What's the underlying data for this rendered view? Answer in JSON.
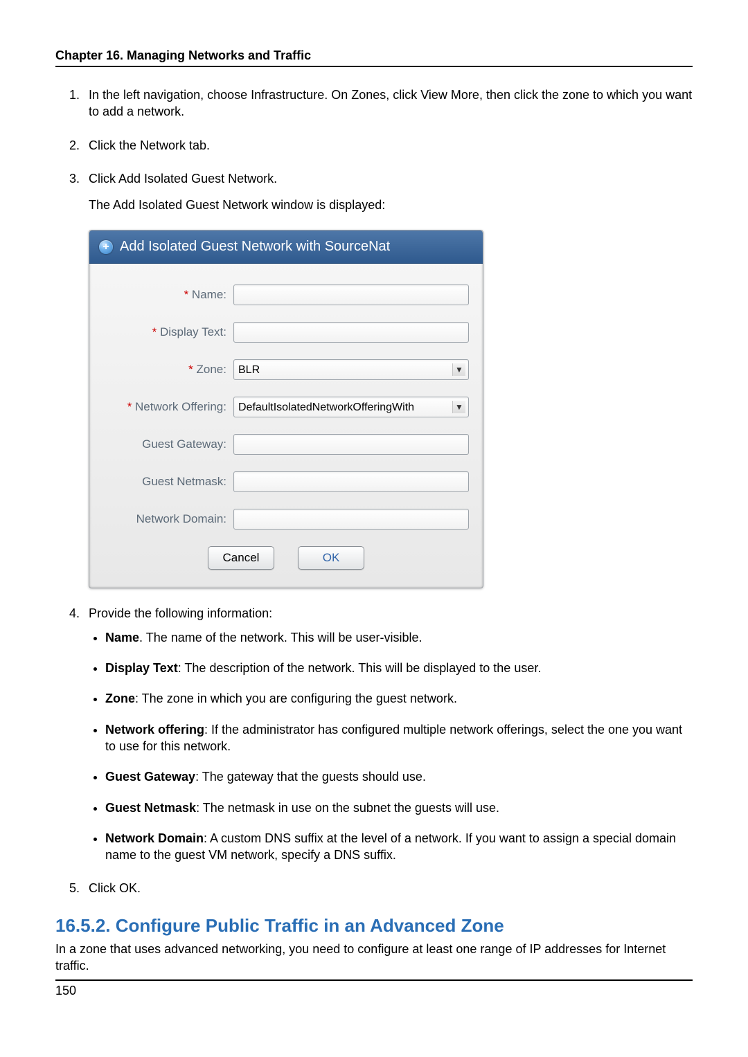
{
  "chapter_header": "Chapter 16. Managing Networks and Traffic",
  "steps": {
    "s1": "In the left navigation, choose Infrastructure. On Zones, click View More, then click the zone to which you want to add a network.",
    "s2": "Click the Network tab.",
    "s3": "Click Add Isolated Guest Network.",
    "s3_sub": "The Add Isolated Guest Network window is displayed:",
    "s4": "Provide the following information:",
    "s5": "Click OK."
  },
  "dialog": {
    "title": "Add Isolated Guest Network with SourceNat",
    "labels": {
      "name": "Name:",
      "display_text": "Display Text:",
      "zone": "Zone:",
      "network_offering": "Network Offering:",
      "guest_gateway": "Guest Gateway:",
      "guest_netmask": "Guest Netmask:",
      "network_domain": "Network Domain:",
      "req": "* "
    },
    "values": {
      "name": "",
      "display_text": "",
      "zone": "BLR",
      "network_offering": "DefaultIsolatedNetworkOfferingWith",
      "guest_gateway": "",
      "guest_netmask": "",
      "network_domain": ""
    },
    "buttons": {
      "cancel": "Cancel",
      "ok": "OK"
    }
  },
  "info_items": {
    "name_b": "Name",
    "name_t": ". The name of the network. This will be user-visible.",
    "display_text_b": "Display Text",
    "display_text_t": ": The description of the network. This will be displayed to the user.",
    "zone_b": "Zone",
    "zone_t": ": The zone in which you are configuring the guest network.",
    "network_offering_b": "Network offering",
    "network_offering_t": ": If the administrator has configured multiple network offerings, select the one you want to use for this network.",
    "guest_gateway_b": "Guest Gateway",
    "guest_gateway_t": ": The gateway that the guests should use.",
    "guest_netmask_b": "Guest Netmask",
    "guest_netmask_t": ": The netmask in use on the subnet the guests will use.",
    "network_domain_b": "Network Domain",
    "network_domain_t": ": A custom DNS suffix at the level of a network. If you want to assign a special domain name to the guest VM network, specify a DNS suffix."
  },
  "section": {
    "heading": "16.5.2. Configure Public Traffic in an Advanced Zone",
    "text": "In a zone that uses advanced networking, you need to configure at least one range of IP addresses for Internet traffic."
  },
  "page_number": "150"
}
